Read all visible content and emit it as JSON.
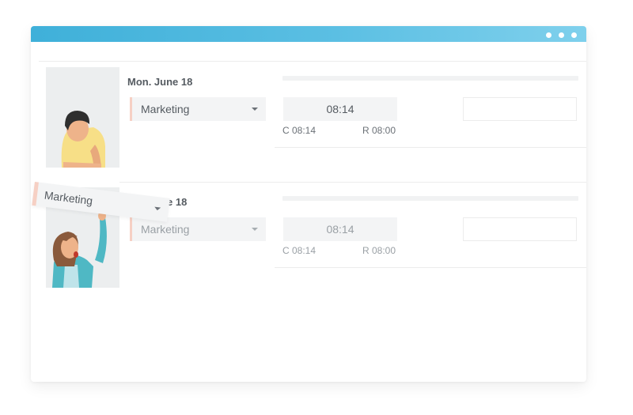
{
  "entries": [
    {
      "date": "Mon. June 18",
      "department": "Marketing",
      "time": "08:14",
      "checkin": "C 08:14",
      "recorded": "R 08:00"
    },
    {
      "date_visible_tail": "e 18",
      "department": "Marketing",
      "time": "08:14",
      "checkin": "C 08:14",
      "recorded": "R 08:00"
    }
  ],
  "dragged_selector": {
    "department": "Marketing"
  },
  "colors": {
    "titlebar_start": "#3fb0d9",
    "titlebar_end": "#7fd0ec",
    "select_accent": "#f6d0c4",
    "field_bg": "#f3f4f5"
  }
}
